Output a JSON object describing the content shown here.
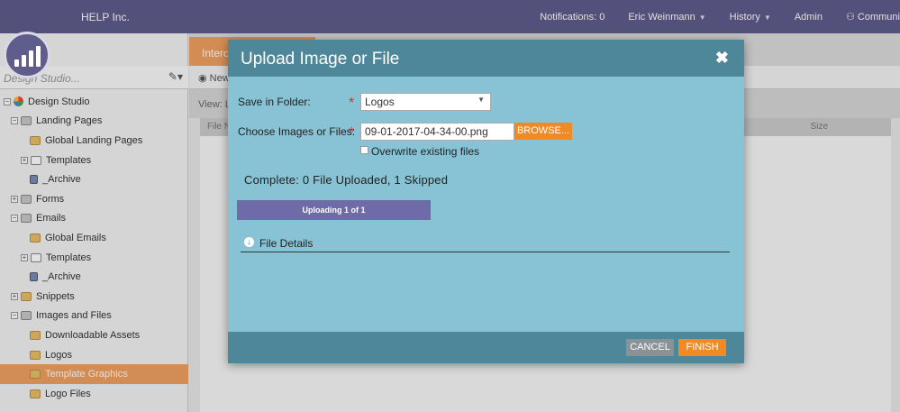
{
  "topbar": {
    "company": "HELP Inc.",
    "notifications": "Notifications: 0",
    "user": "Eric Weinmann",
    "history": "History",
    "admin": "Admin",
    "community": "Communi"
  },
  "sidebar": {
    "search_placeholder": "Design Studio...",
    "items": [
      {
        "label": "Design Studio",
        "icon": "design-studio-icon"
      },
      {
        "label": "Landing Pages",
        "icon": "landing-pages-icon"
      },
      {
        "label": "Global Landing Pages",
        "icon": "folder-icon"
      },
      {
        "label": "Templates",
        "icon": "template-icon"
      },
      {
        "label": "_Archive",
        "icon": "archive-icon"
      },
      {
        "label": "Forms",
        "icon": "forms-icon"
      },
      {
        "label": "Emails",
        "icon": "emails-icon"
      },
      {
        "label": "Global Emails",
        "icon": "folder-icon"
      },
      {
        "label": "Templates",
        "icon": "template-icon"
      },
      {
        "label": "_Archive",
        "icon": "archive-icon"
      },
      {
        "label": "Snippets",
        "icon": "snippets-icon"
      },
      {
        "label": "Images and Files",
        "icon": "images-icon"
      },
      {
        "label": "Downloadable Assets",
        "icon": "folder-icon"
      },
      {
        "label": "Logos",
        "icon": "folder-icon"
      },
      {
        "label": "Template Graphics",
        "icon": "folder-icon"
      },
      {
        "label": "Logo Files",
        "icon": "folder-icon"
      }
    ]
  },
  "main": {
    "tab_label": "Interc",
    "toolbar_new": "New",
    "view_label": "View: L",
    "col_file": "File N",
    "col_size": "Size"
  },
  "dialog": {
    "title": "Upload Image or File",
    "close_icon": "close-icon",
    "folder_label": "Save in Folder:",
    "folder_value": "Logos",
    "files_label": "Choose Images or Files:",
    "file_value": "09-01-2017-04-34-00.png",
    "browse_label": "BROWSE...",
    "overwrite_label": "Overwrite existing files",
    "status": "Complete: 0 File Uploaded, 1 Skipped",
    "progress_label": "Uploading 1 of 1",
    "progress_fraction": 1.0,
    "details_label": "File Details",
    "cancel_label": "CANCEL",
    "finish_label": "FINISH"
  },
  "colors": {
    "topbar": "#5f5d8c",
    "dialog_header": "#4d8799",
    "dialog_body": "#87c3d4",
    "accent_orange": "#f08a24",
    "progress": "#6f6aa8"
  }
}
